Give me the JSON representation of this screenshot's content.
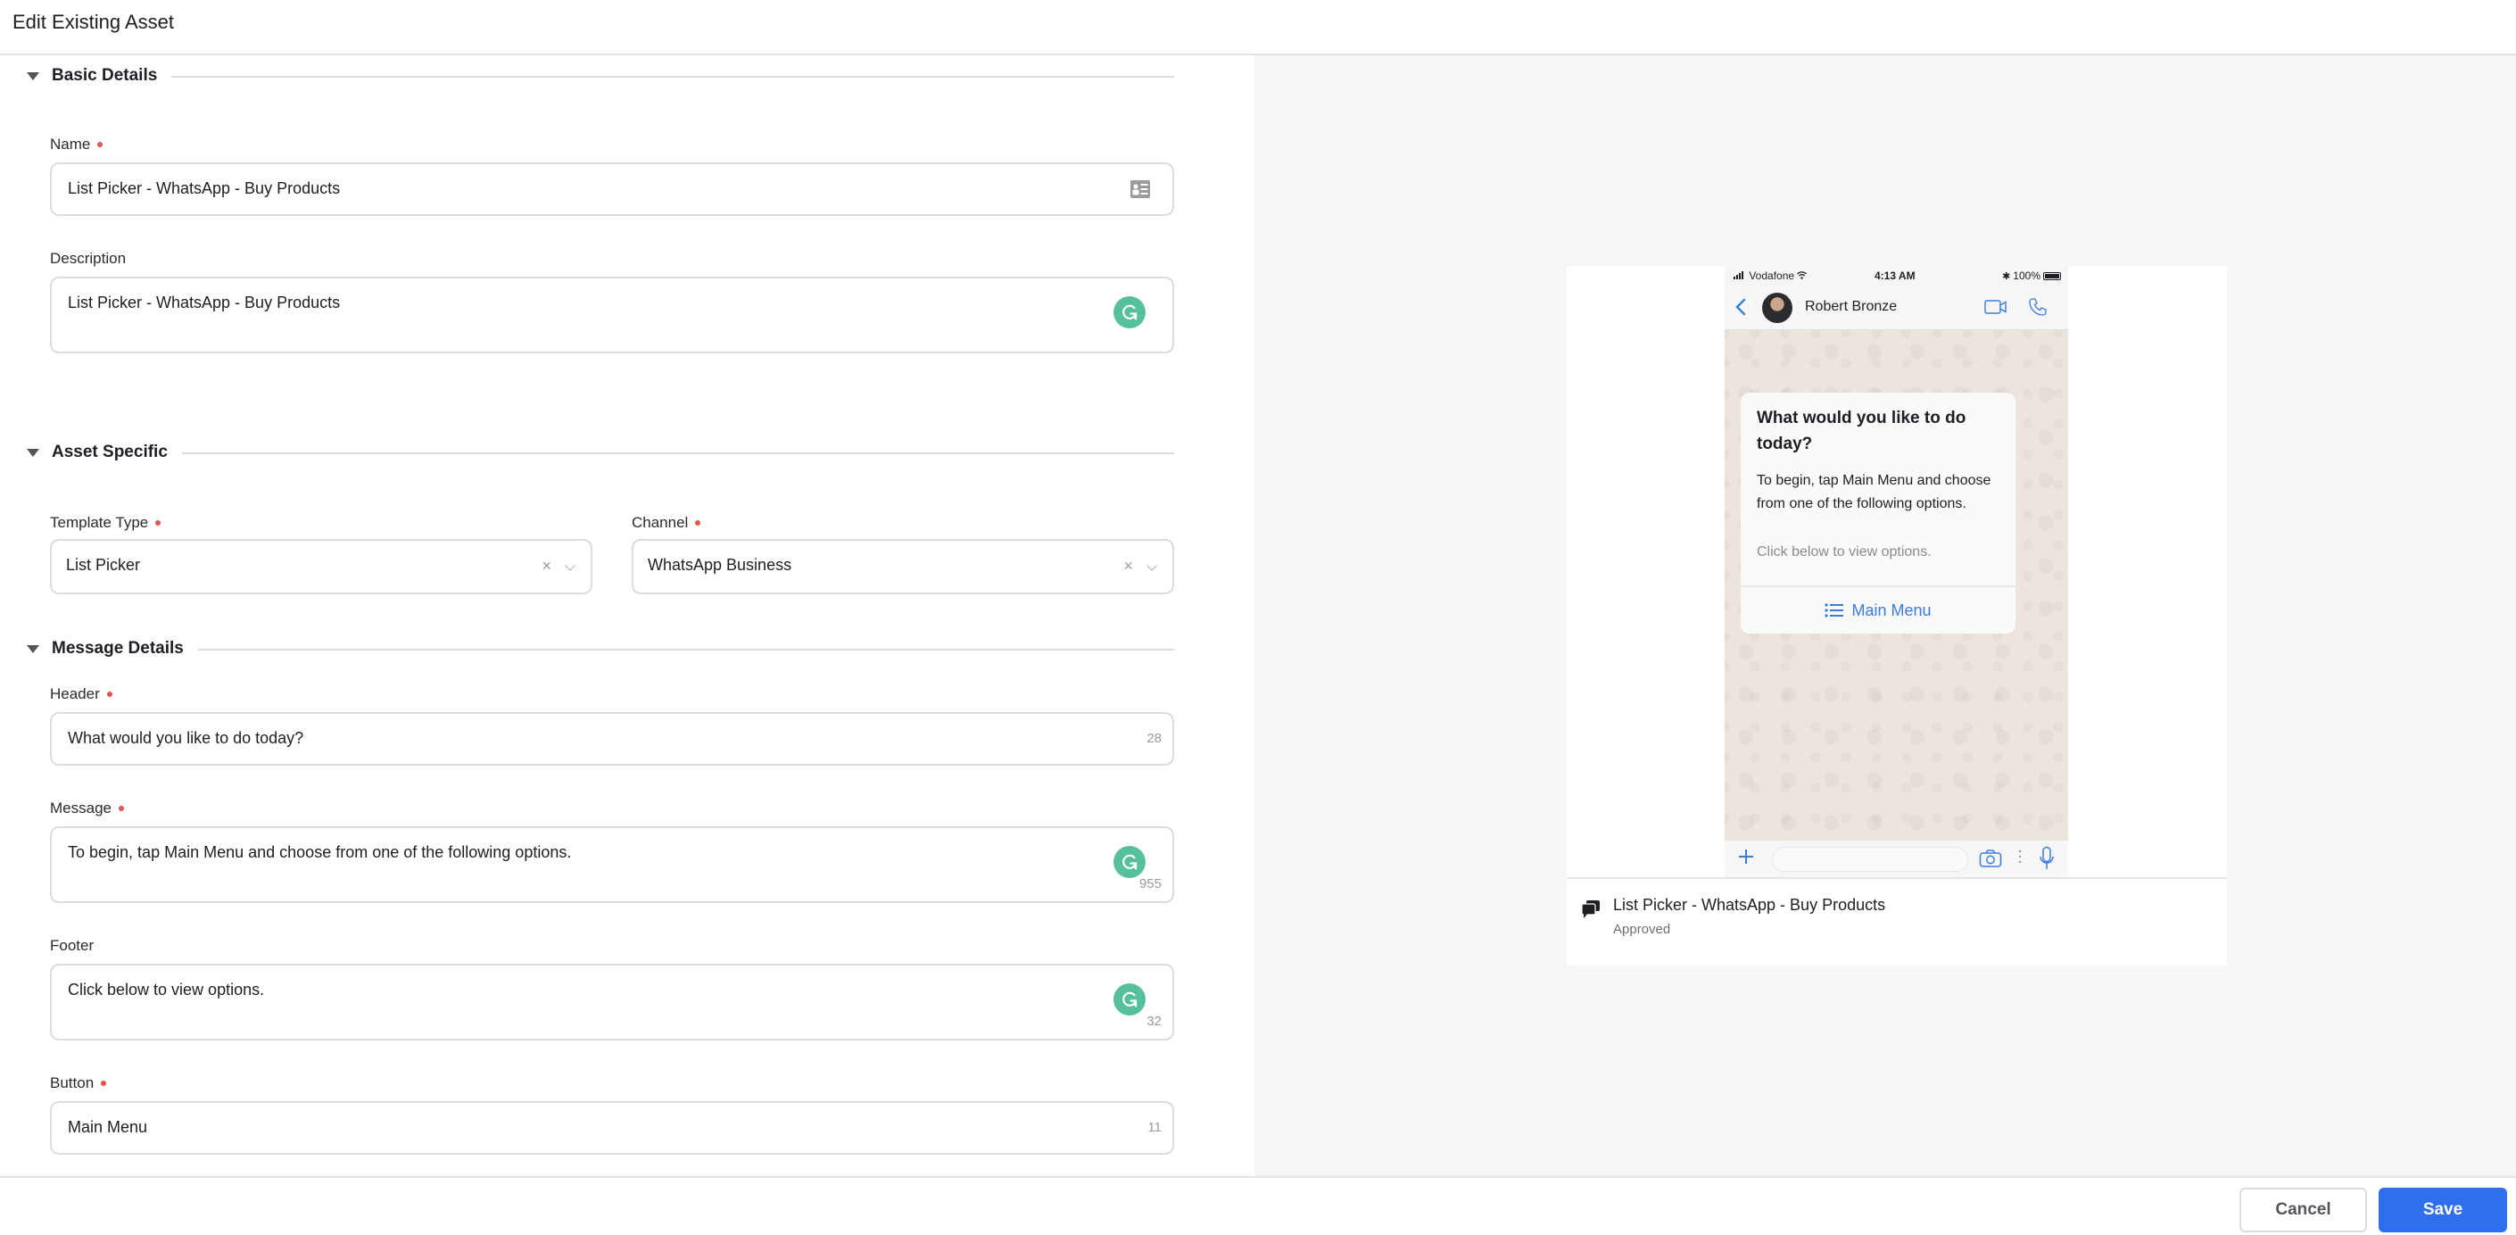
{
  "header": {
    "title": "Edit Existing Asset"
  },
  "sections": {
    "basic": {
      "label": "Basic Details"
    },
    "asset_specific": {
      "label": "Asset Specific"
    },
    "message_details": {
      "label": "Message Details"
    }
  },
  "fields": {
    "name": {
      "label": "Name",
      "required": true,
      "value": "List Picker - WhatsApp - Buy Products",
      "icon": "contact-card-icon"
    },
    "description": {
      "label": "Description",
      "required": false,
      "value": "List Picker - WhatsApp - Buy Products"
    },
    "template_type": {
      "label": "Template Type",
      "required": true,
      "value": "List Picker"
    },
    "channel": {
      "label": "Channel",
      "required": true,
      "value": "WhatsApp Business"
    },
    "header": {
      "label": "Header",
      "required": true,
      "value": "What would you like to do today?",
      "counter": "28"
    },
    "message": {
      "label": "Message",
      "required": true,
      "value": "To begin, tap Main Menu and choose from one of the following options.",
      "counter": "955"
    },
    "footer": {
      "label": "Footer",
      "required": false,
      "value": "Click below to view options.",
      "counter": "32"
    },
    "button": {
      "label": "Button",
      "required": true,
      "value": "Main Menu",
      "counter": "11"
    }
  },
  "select_controls": {
    "clear_glyph": "×"
  },
  "actions": {
    "cancel": "Cancel",
    "save": "Save"
  },
  "preview": {
    "status_bar": {
      "carrier": "Vodafone",
      "time": "4:13 AM",
      "battery": "100%"
    },
    "contact_name": "Robert Bronze",
    "bubble": {
      "header": "What would you like to do today?",
      "message": "To begin, tap Main Menu and choose from one of the following options.",
      "footer": "Click below to view options.",
      "button": "Main Menu"
    },
    "asset_name": "List Picker - WhatsApp - Buy Products",
    "asset_status": "Approved"
  },
  "colors": {
    "primary": "#2f6fed",
    "required": "#e5534b",
    "grammarly": "#55c09b",
    "whatsapp_link": "#3a7be0",
    "chat_bg": "#ece5dd",
    "panel_bg": "#f6f6f8"
  }
}
